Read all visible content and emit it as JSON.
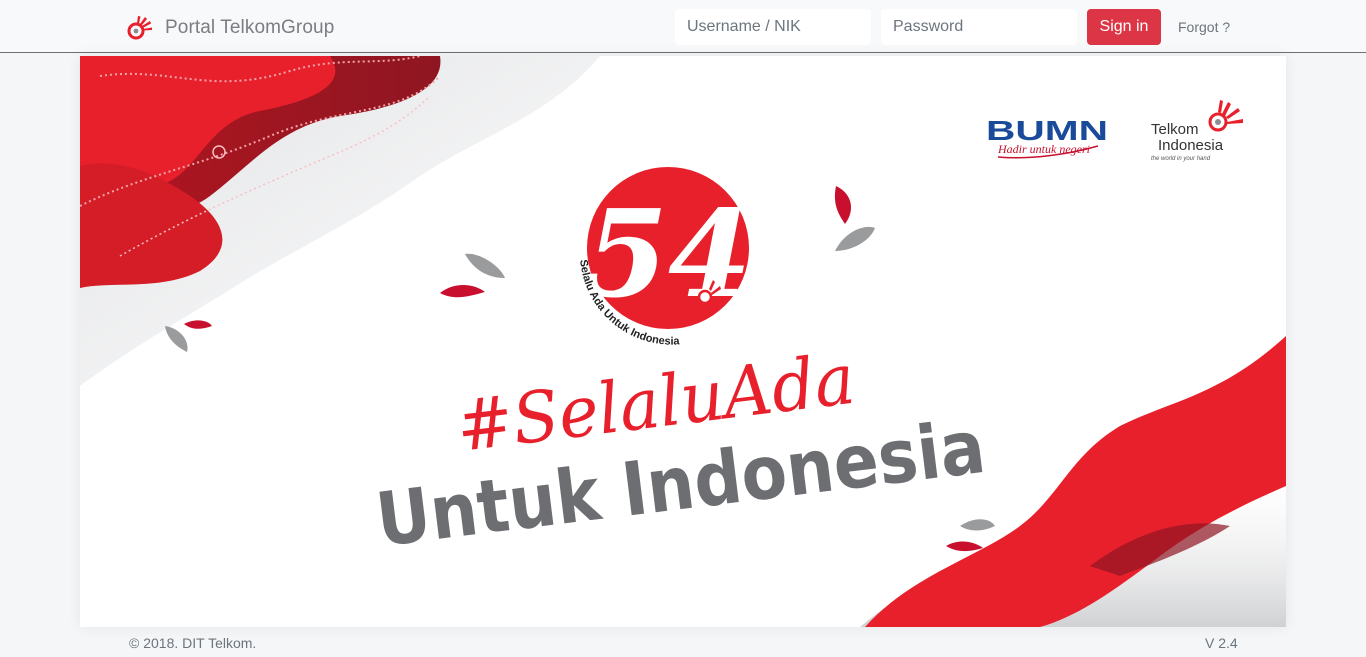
{
  "header": {
    "brand_label": "Portal TelkomGroup",
    "logo_icon": "telkom-logo-icon",
    "username_placeholder": "Username / NIK",
    "password_placeholder": "Password",
    "signin_label": "Sign in",
    "forgot_label": "Forgot ?"
  },
  "banner": {
    "bumn_title": "BUMN",
    "bumn_tagline": "Hadir untuk negeri",
    "telkom_line1": "Telkom",
    "telkom_line2": "Indonesia",
    "telkom_tagline": "the world in your hand",
    "anniversary_number": "54",
    "anniversary_ring_text": "Selalu Ada Untuk Indonesia",
    "hashtag": "#SelaluAda",
    "headline": "Untuk Indonesia"
  },
  "footer": {
    "copyright": "© 2018. DIT Telkom.",
    "version": "V 2.4"
  },
  "colors": {
    "accent_red": "#dc3545",
    "banner_red": "#e8202b",
    "headline_gray": "#6d6e71"
  }
}
